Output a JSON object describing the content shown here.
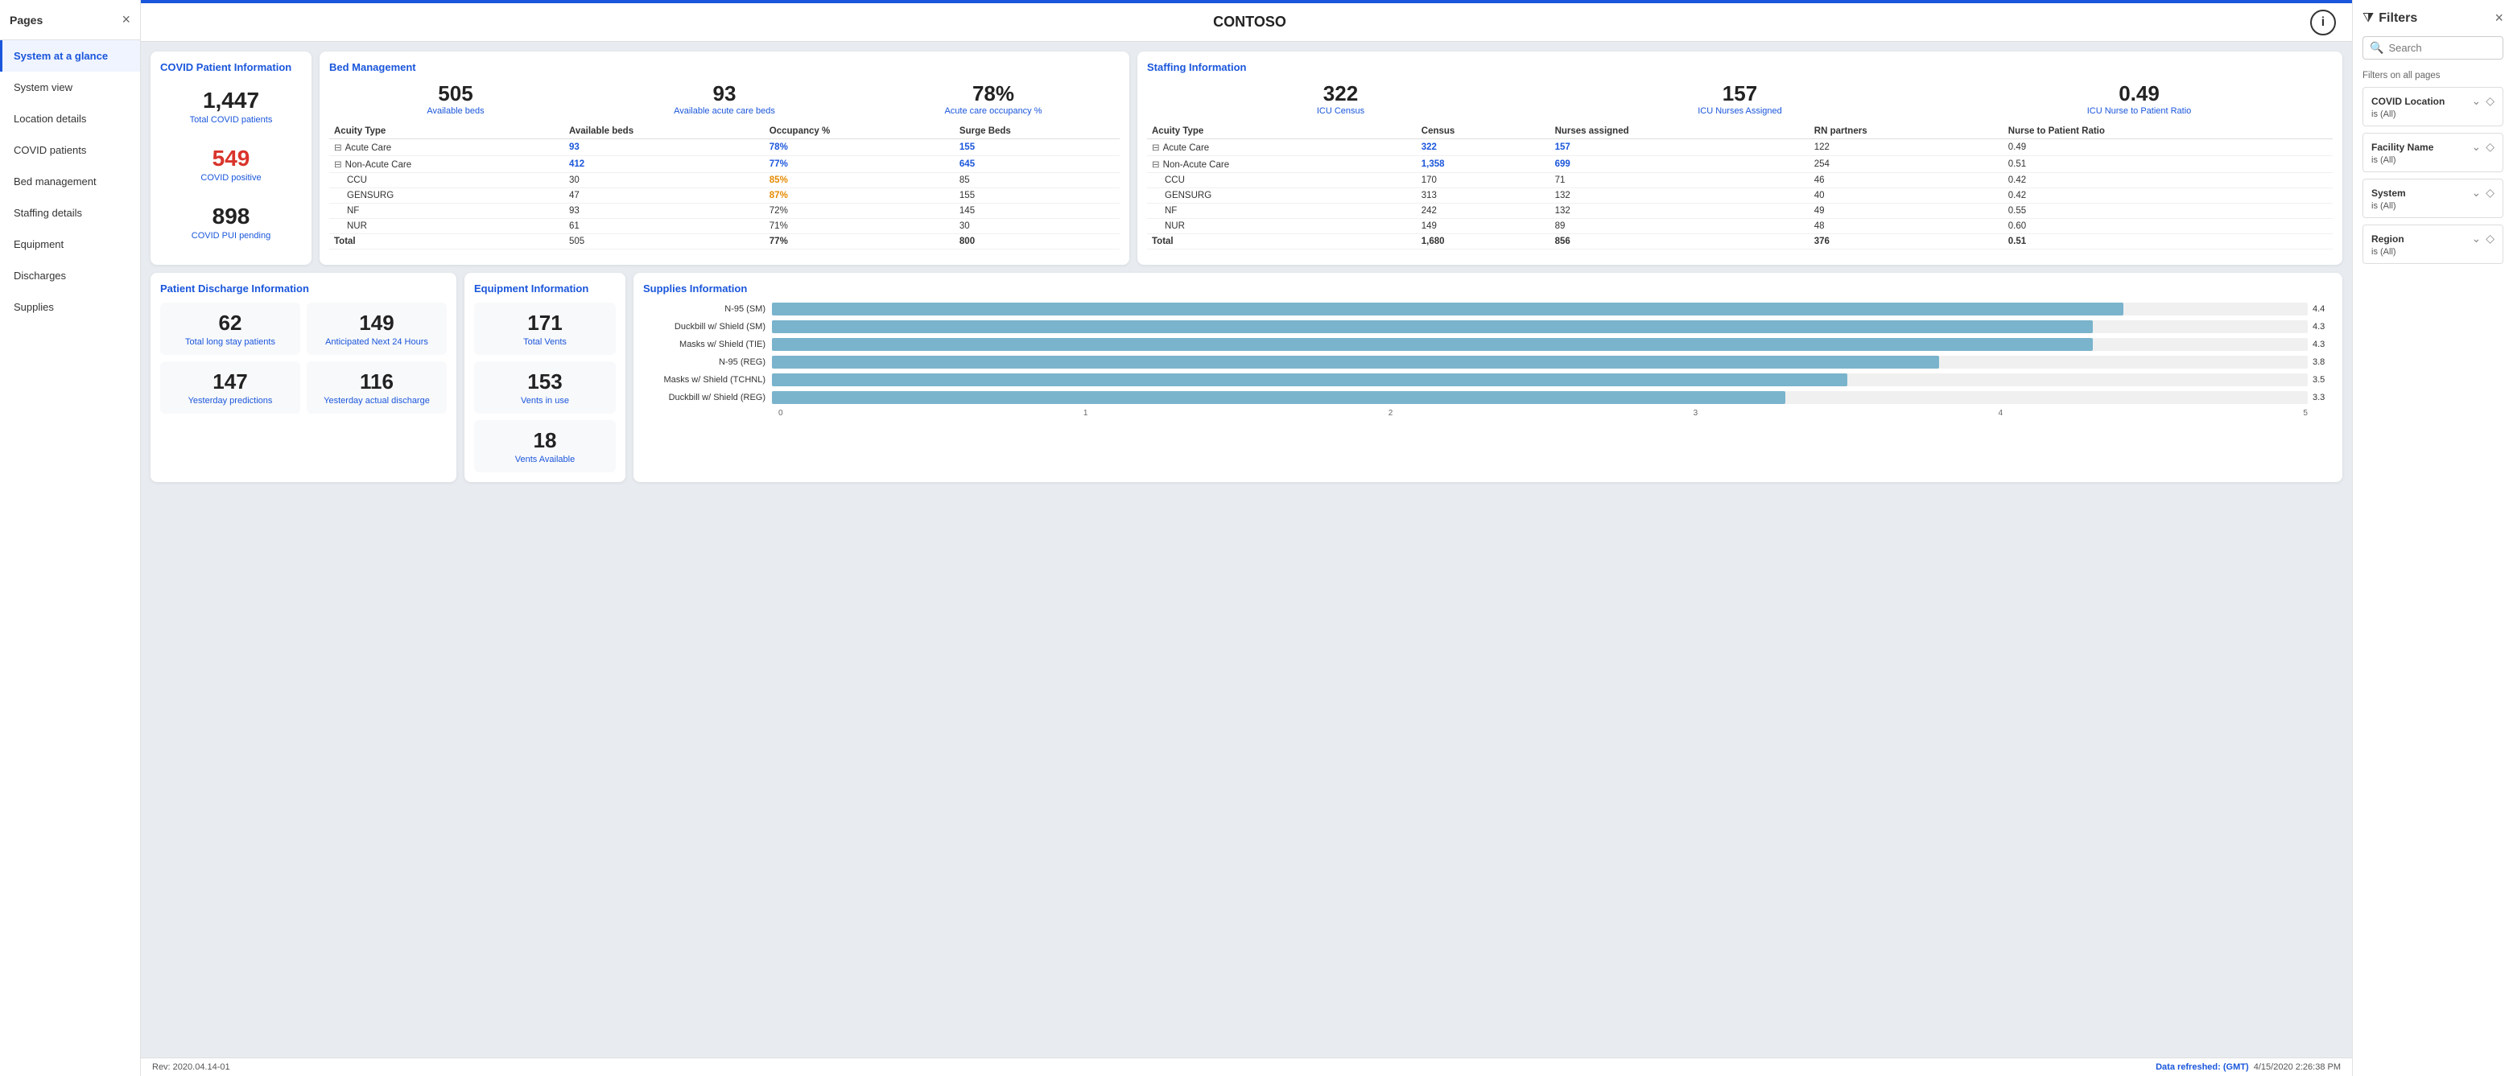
{
  "sidebar": {
    "title": "Pages",
    "close_label": "×",
    "items": [
      {
        "id": "system-at-a-glance",
        "label": "System at a glance",
        "active": true
      },
      {
        "id": "system-view",
        "label": "System view",
        "active": false
      },
      {
        "id": "location-details",
        "label": "Location details",
        "active": false
      },
      {
        "id": "covid-patients",
        "label": "COVID patients",
        "active": false
      },
      {
        "id": "bed-management",
        "label": "Bed management",
        "active": false
      },
      {
        "id": "staffing-details",
        "label": "Staffing details",
        "active": false
      },
      {
        "id": "equipment",
        "label": "Equipment",
        "active": false
      },
      {
        "id": "discharges",
        "label": "Discharges",
        "active": false
      },
      {
        "id": "supplies",
        "label": "Supplies",
        "active": false
      }
    ]
  },
  "topbar": {
    "title": "CONTOSO",
    "info_icon": "i"
  },
  "covid": {
    "section_title": "COVID Patient Information",
    "total_number": "1,447",
    "total_label": "Total COVID patients",
    "positive_number": "549",
    "positive_label": "COVID positive",
    "pui_number": "898",
    "pui_label": "COVID PUI pending"
  },
  "bed_management": {
    "section_title": "Bed Management",
    "stats": [
      {
        "number": "505",
        "label": "Available beds"
      },
      {
        "number": "93",
        "label": "Available acute care beds"
      },
      {
        "number": "78%",
        "label": "Acute care occupancy %"
      }
    ],
    "table_headers": [
      "Acuity Type",
      "Available beds",
      "Occupancy %",
      "Surge Beds"
    ],
    "table_rows": [
      {
        "type": "Acute Care",
        "available": "93",
        "occupancy": "78%",
        "surge": "155",
        "highlight": "blue",
        "expanded": true
      },
      {
        "type": "Non-Acute Care",
        "available": "412",
        "occupancy": "77%",
        "surge": "645",
        "highlight": "blue",
        "expanded": true
      },
      {
        "type": "CCU",
        "available": "30",
        "occupancy": "85%",
        "surge": "85",
        "highlight": "orange",
        "indent": true
      },
      {
        "type": "GENSURG",
        "available": "47",
        "occupancy": "87%",
        "surge": "155",
        "highlight": "orange",
        "indent": true
      },
      {
        "type": "NF",
        "available": "93",
        "occupancy": "72%",
        "surge": "145",
        "indent": true
      },
      {
        "type": "NUR",
        "available": "61",
        "occupancy": "71%",
        "surge": "30",
        "indent": true
      },
      {
        "type": "Total",
        "available": "505",
        "occupancy": "77%",
        "surge": "800",
        "bold": true
      }
    ]
  },
  "staffing": {
    "section_title": "Staffing Information",
    "stats": [
      {
        "number": "322",
        "label": "ICU Census"
      },
      {
        "number": "157",
        "label": "ICU Nurses Assigned"
      },
      {
        "number": "0.49",
        "label": "ICU Nurse to Patient Ratio"
      }
    ],
    "table_headers": [
      "Acuity Type",
      "Census",
      "Nurses assigned",
      "RN partners",
      "Nurse to Patient Ratio"
    ],
    "table_rows": [
      {
        "type": "Acute Care",
        "census": "322",
        "nurses": "157",
        "rn": "122",
        "ratio": "0.49",
        "highlight": "blue",
        "expanded": true
      },
      {
        "type": "Non-Acute Care",
        "census": "1,358",
        "nurses": "699",
        "rn": "254",
        "ratio": "0.51",
        "highlight": "blue",
        "expanded": true
      },
      {
        "type": "CCU",
        "census": "170",
        "nurses": "71",
        "rn": "46",
        "ratio": "0.42",
        "indent": true
      },
      {
        "type": "GENSURG",
        "census": "313",
        "nurses": "132",
        "rn": "40",
        "ratio": "0.42",
        "indent": true
      },
      {
        "type": "NF",
        "census": "242",
        "nurses": "132",
        "rn": "49",
        "ratio": "0.55",
        "indent": true
      },
      {
        "type": "NUR",
        "census": "149",
        "nurses": "89",
        "rn": "48",
        "ratio": "0.60",
        "indent": true
      },
      {
        "type": "Total",
        "census": "1,680",
        "nurses": "856",
        "rn": "376",
        "ratio": "0.51",
        "bold": true
      }
    ]
  },
  "discharge": {
    "section_title": "Patient Discharge Information",
    "stats": [
      {
        "number": "62",
        "label": "Total long stay patients"
      },
      {
        "number": "149",
        "label": "Anticipated Next 24 Hours"
      },
      {
        "number": "147",
        "label": "Yesterday predictions"
      },
      {
        "number": "116",
        "label": "Yesterday actual discharge"
      }
    ]
  },
  "equipment": {
    "section_title": "Equipment Information",
    "stats": [
      {
        "number": "171",
        "label": "Total Vents"
      },
      {
        "number": "153",
        "label": "Vents in use"
      },
      {
        "number": "18",
        "label": "Vents Available"
      }
    ]
  },
  "supplies": {
    "section_title": "Supplies Information",
    "bars": [
      {
        "label": "N-95 (SM)",
        "value": 4.4,
        "max": 5
      },
      {
        "label": "Duckbill w/ Shield (SM)",
        "value": 4.3,
        "max": 5
      },
      {
        "label": "Masks w/ Shield (TIE)",
        "value": 4.3,
        "max": 5
      },
      {
        "label": "N-95 (REG)",
        "value": 3.8,
        "max": 5
      },
      {
        "label": "Masks w/ Shield (TCHNL)",
        "value": 3.5,
        "max": 5
      },
      {
        "label": "Duckbill w/ Shield (REG)",
        "value": 3.3,
        "max": 5
      }
    ],
    "axis_labels": [
      "0",
      "1",
      "2",
      "3",
      "4",
      "5"
    ]
  },
  "footer": {
    "rev": "Rev: 2020.04.14-01",
    "refresh_label": "Data refreshed: (GMT)",
    "refresh_time": "4/15/2020 2:26:38 PM"
  },
  "filters": {
    "title": "Filters",
    "search_placeholder": "Search",
    "section_label": "Filters on all pages",
    "items": [
      {
        "name": "COVID Location",
        "value": "is (All)"
      },
      {
        "name": "Facility Name",
        "value": "is (All)"
      },
      {
        "name": "System",
        "value": "is (All)"
      },
      {
        "name": "Region",
        "value": "is (All)"
      }
    ]
  }
}
